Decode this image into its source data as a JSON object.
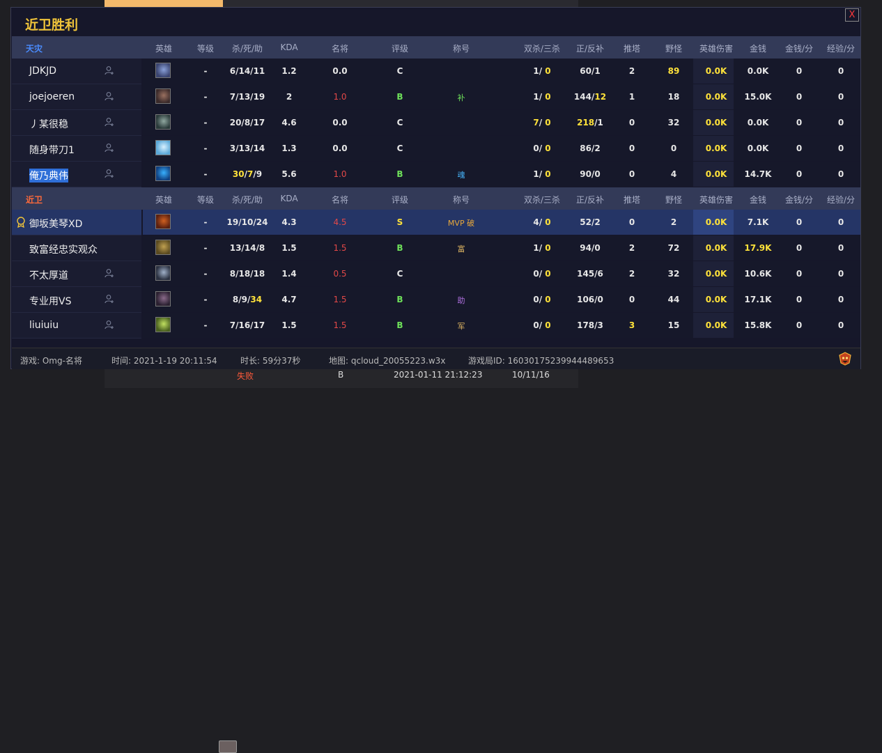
{
  "background": {
    "bottom_row": {
      "result": "失败",
      "grade": "B",
      "time": "2021-01-11 21:12:23",
      "kda": "10/11/16"
    }
  },
  "dialog": {
    "title": "近卫胜利",
    "close_label": "X"
  },
  "columns": {
    "hero": "英雄",
    "level": "等级",
    "ksd": "杀/死/助",
    "kda": "KDA",
    "title": "名将",
    "grade": "评级",
    "nickname": "称号",
    "multi": "双杀/三杀",
    "cs": "正/反补",
    "towers": "推塔",
    "jungle": "野怪",
    "damage": "英雄伤害",
    "gold": "金钱",
    "gpm": "金钱/分",
    "xpm": "经验/分"
  },
  "teams": [
    {
      "name": "天灾",
      "color": "#4a8cff",
      "players": [
        {
          "name": "JDKJD",
          "level": "-",
          "k": "6",
          "d": "14",
          "a": "11",
          "kda": "1.2",
          "title": "0.0",
          "grade": "C",
          "badge": "",
          "dbl": "1",
          "trp": "0",
          "cs_last": "60",
          "cs_deny": "1",
          "towers": "2",
          "jungle": "89",
          "damage": "0.0K",
          "gold": "0.0K",
          "gpm": "0",
          "xpm": "0"
        },
        {
          "name": "joejoeren",
          "level": "-",
          "k": "7",
          "d": "13",
          "a": "19",
          "kda": "2",
          "title": "1.0",
          "grade": "B",
          "badge": "补",
          "dbl": "1",
          "trp": "0",
          "cs_last": "144",
          "cs_deny": "12",
          "towers": "1",
          "jungle": "18",
          "damage": "0.0K",
          "gold": "15.0K",
          "gpm": "0",
          "xpm": "0"
        },
        {
          "name": "丿某很稳",
          "level": "-",
          "k": "20",
          "d": "8",
          "a": "17",
          "kda": "4.6",
          "title": "0.0",
          "grade": "C",
          "badge": "",
          "dbl": "7",
          "trp": "0",
          "cs_last": "218",
          "cs_deny": "1",
          "towers": "0",
          "jungle": "32",
          "damage": "0.0K",
          "gold": "0.0K",
          "gpm": "0",
          "xpm": "0"
        },
        {
          "name": "随身带刀1",
          "level": "-",
          "k": "3",
          "d": "13",
          "a": "14",
          "kda": "1.3",
          "title": "0.0",
          "grade": "C",
          "badge": "",
          "dbl": "0",
          "trp": "0",
          "cs_last": "86",
          "cs_deny": "2",
          "towers": "0",
          "jungle": "0",
          "damage": "0.0K",
          "gold": "0.0K",
          "gpm": "0",
          "xpm": "0"
        },
        {
          "name": "俺乃典伟",
          "level": "-",
          "k": "30",
          "d": "7",
          "a": "9",
          "kda": "5.6",
          "title": "1.0",
          "grade": "B",
          "badge": "魂",
          "dbl": "1",
          "trp": "0",
          "cs_last": "90",
          "cs_deny": "0",
          "towers": "0",
          "jungle": "4",
          "damage": "0.0K",
          "gold": "14.7K",
          "gpm": "0",
          "xpm": "0"
        }
      ]
    },
    {
      "name": "近卫",
      "color": "#ff6a3a",
      "players": [
        {
          "name": "御坂美琴XD",
          "level": "-",
          "k": "19",
          "d": "10",
          "a": "24",
          "kda": "4.3",
          "title": "4.5",
          "grade": "S",
          "badge": "MVP 破",
          "dbl": "4",
          "trp": "0",
          "cs_last": "52",
          "cs_deny": "2",
          "towers": "0",
          "jungle": "2",
          "damage": "0.0K",
          "gold": "7.1K",
          "gpm": "0",
          "xpm": "0"
        },
        {
          "name": "致富经忠实观众",
          "level": "-",
          "k": "13",
          "d": "14",
          "a": "8",
          "kda": "1.5",
          "title": "1.5",
          "grade": "B",
          "badge": "富",
          "dbl": "1",
          "trp": "0",
          "cs_last": "94",
          "cs_deny": "0",
          "towers": "2",
          "jungle": "72",
          "damage": "0.0K",
          "gold": "17.9K",
          "gpm": "0",
          "xpm": "0"
        },
        {
          "name": "不太厚道",
          "level": "-",
          "k": "8",
          "d": "18",
          "a": "18",
          "kda": "1.4",
          "title": "0.5",
          "grade": "C",
          "badge": "",
          "dbl": "0",
          "trp": "0",
          "cs_last": "145",
          "cs_deny": "6",
          "towers": "2",
          "jungle": "32",
          "damage": "0.0K",
          "gold": "10.6K",
          "gpm": "0",
          "xpm": "0"
        },
        {
          "name": "专业用VS",
          "level": "-",
          "k": "8",
          "d": "9",
          "a": "34",
          "kda": "4.7",
          "title": "1.5",
          "grade": "B",
          "badge": "助",
          "dbl": "0",
          "trp": "0",
          "cs_last": "106",
          "cs_deny": "0",
          "towers": "0",
          "jungle": "44",
          "damage": "0.0K",
          "gold": "17.1K",
          "gpm": "0",
          "xpm": "0"
        },
        {
          "name": "liuiuiu",
          "level": "-",
          "k": "7",
          "d": "16",
          "a": "17",
          "kda": "1.5",
          "title": "1.5",
          "grade": "B",
          "badge": "军",
          "dbl": "0",
          "trp": "0",
          "cs_last": "178",
          "cs_deny": "3",
          "towers": "3",
          "jungle": "15",
          "damage": "0.0K",
          "gold": "15.8K",
          "gpm": "0",
          "xpm": "0"
        }
      ]
    }
  ],
  "footer": {
    "game": "游戏: Omg-名将",
    "time": "时间: 2021-1-19 20:11:54",
    "duration": "时长: 59分37秒",
    "map": "地图: qcloud_20055223.w3x",
    "match_id": "游戏局ID: 16030175239944489653"
  }
}
